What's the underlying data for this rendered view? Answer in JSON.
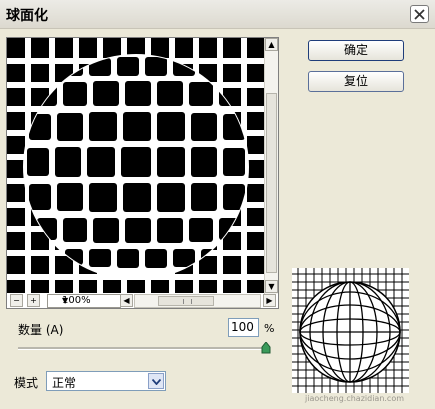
{
  "dialog": {
    "title": "球面化"
  },
  "buttons": {
    "ok_label": "确定",
    "reset_label": "复位"
  },
  "preview": {
    "zoom_out_symbol": "−",
    "zoom_in_symbol": "+",
    "zoom_value": "100%",
    "zoom_caret": "▼",
    "scroll_left_symbol": "◀",
    "scroll_right_symbol": "▶",
    "scroll_up_symbol": "▲",
    "scroll_down_symbol": "▼"
  },
  "amount": {
    "label": "数量 (A)",
    "value": "100",
    "unit": "%",
    "slider_fraction": 1.0
  },
  "mode": {
    "label": "模式",
    "selected": "正常"
  },
  "watermark": "jiaocheng.chazidian.com",
  "colors": {
    "dialog_bg": "#ece9d8",
    "button_border": "#1f3d7a",
    "slider_thumb": "#3a9a5a"
  },
  "icons": {
    "close": "close-icon",
    "dropdown": "chevron-down-icon",
    "slider_thumb": "slider-thumb-icon"
  }
}
